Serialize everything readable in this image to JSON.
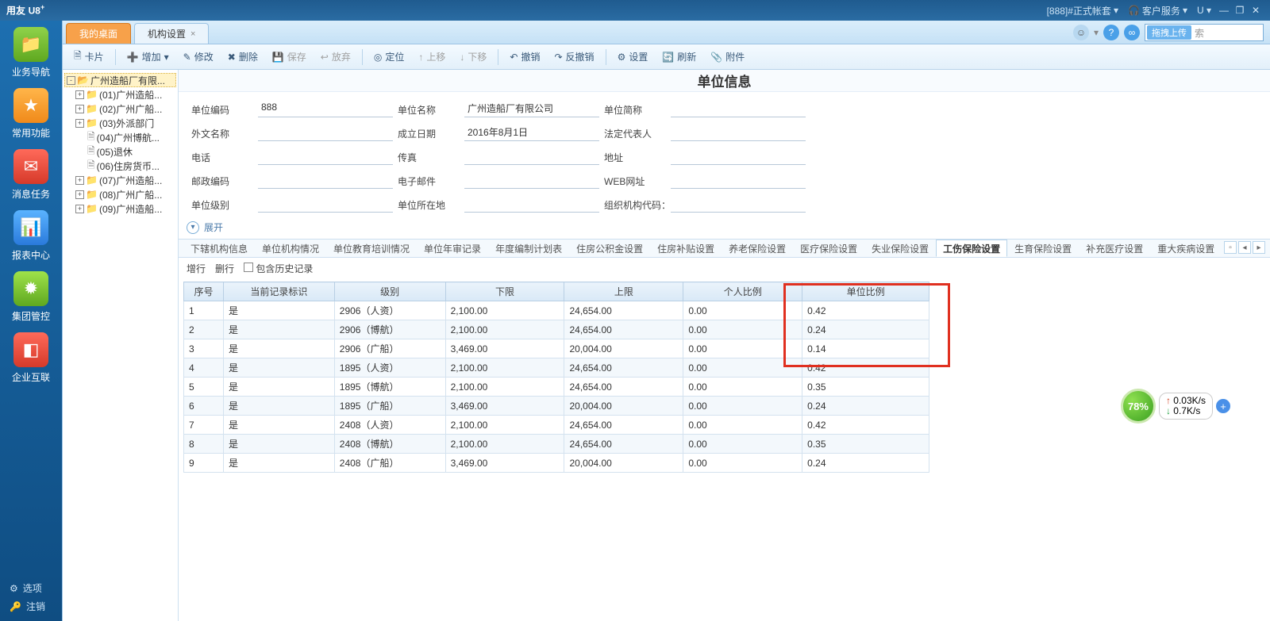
{
  "titlebar": {
    "logo": "用友",
    "prod": "U8",
    "sup": "+",
    "account": "[888]#正式帐套",
    "service": "客户服务"
  },
  "leftnav": {
    "items": [
      {
        "label": "业务导航"
      },
      {
        "label": "常用功能"
      },
      {
        "label": "消息任务"
      },
      {
        "label": "报表中心"
      },
      {
        "label": "集团管控"
      },
      {
        "label": "企业互联"
      }
    ],
    "options": "选项",
    "logout": "注销"
  },
  "tabs": {
    "t1": "我的桌面",
    "t2": "机构设置",
    "searchpill": "拖拽上传"
  },
  "toolbar": {
    "card": "卡片",
    "add": "增加",
    "edit": "修改",
    "del": "删除",
    "save": "保存",
    "discard": "放弃",
    "locate": "定位",
    "up": "上移",
    "down": "下移",
    "undo": "撤销",
    "redo": "反撤销",
    "setting": "设置",
    "refresh": "刷新",
    "attach": "附件"
  },
  "tree": {
    "root": "广州造船厂有限...",
    "items": [
      "(01)广州造船...",
      "(02)广州广船...",
      "(03)外派部门",
      "(04)广州博航...",
      "(05)退休",
      "(06)住房货币...",
      "(07)广州造船...",
      "(08)广州广船...",
      "(09)广州造船..."
    ]
  },
  "page": {
    "title": "单位信息",
    "expand": "展开"
  },
  "form": {
    "r1": [
      {
        "l": "单位编码",
        "v": "888"
      },
      {
        "l": "单位名称",
        "v": "广州造船厂有限公司"
      },
      {
        "l": "单位简称",
        "v": ""
      }
    ],
    "r2": [
      {
        "l": "外文名称",
        "v": ""
      },
      {
        "l": "成立日期",
        "v": "2016年8月1日"
      },
      {
        "l": "法定代表人",
        "v": ""
      }
    ],
    "r3": [
      {
        "l": "电话",
        "v": ""
      },
      {
        "l": "传真",
        "v": ""
      },
      {
        "l": "地址",
        "v": ""
      }
    ],
    "r4": [
      {
        "l": "邮政编码",
        "v": ""
      },
      {
        "l": "电子邮件",
        "v": ""
      },
      {
        "l": "WEB网址",
        "v": ""
      }
    ],
    "r5": [
      {
        "l": "单位级别",
        "v": ""
      },
      {
        "l": "单位所在地",
        "v": ""
      },
      {
        "l": "组织机构代码：",
        "v": ""
      }
    ]
  },
  "subtabs": [
    "下辖机构信息",
    "单位机构情况",
    "单位教育培训情况",
    "单位年审记录",
    "年度编制计划表",
    "住房公积金设置",
    "住房补贴设置",
    "养老保险设置",
    "医疗保险设置",
    "失业保险设置",
    "工伤保险设置",
    "生育保险设置",
    "补充医疗设置",
    "重大疾病设置"
  ],
  "subtab_active": 10,
  "actionbar": {
    "addrow": "增行",
    "delrow": "删行",
    "history": "包含历史记录"
  },
  "grid": {
    "headers": [
      "序号",
      "当前记录标识",
      "级别",
      "下限",
      "上限",
      "个人比例",
      "单位比例"
    ],
    "rows": [
      [
        "1",
        "是",
        "2906（人资）",
        "2,100.00",
        "24,654.00",
        "0.00",
        "0.42"
      ],
      [
        "2",
        "是",
        "2906（博航）",
        "2,100.00",
        "24,654.00",
        "0.00",
        "0.24"
      ],
      [
        "3",
        "是",
        "2906（广船）",
        "3,469.00",
        "20,004.00",
        "0.00",
        "0.14"
      ],
      [
        "4",
        "是",
        "1895（人资）",
        "2,100.00",
        "24,654.00",
        "0.00",
        "0.42"
      ],
      [
        "5",
        "是",
        "1895（博航）",
        "2,100.00",
        "24,654.00",
        "0.00",
        "0.35"
      ],
      [
        "6",
        "是",
        "1895（广船）",
        "3,469.00",
        "20,004.00",
        "0.00",
        "0.24"
      ],
      [
        "7",
        "是",
        "2408（人资）",
        "2,100.00",
        "24,654.00",
        "0.00",
        "0.42"
      ],
      [
        "8",
        "是",
        "2408（博航）",
        "2,100.00",
        "24,654.00",
        "0.00",
        "0.35"
      ],
      [
        "9",
        "是",
        "2408（广船）",
        "3,469.00",
        "20,004.00",
        "0.00",
        "0.24"
      ]
    ]
  },
  "speed": {
    "pct": "78%",
    "up": "0.03K/s",
    "dn": "0.7K/s"
  }
}
